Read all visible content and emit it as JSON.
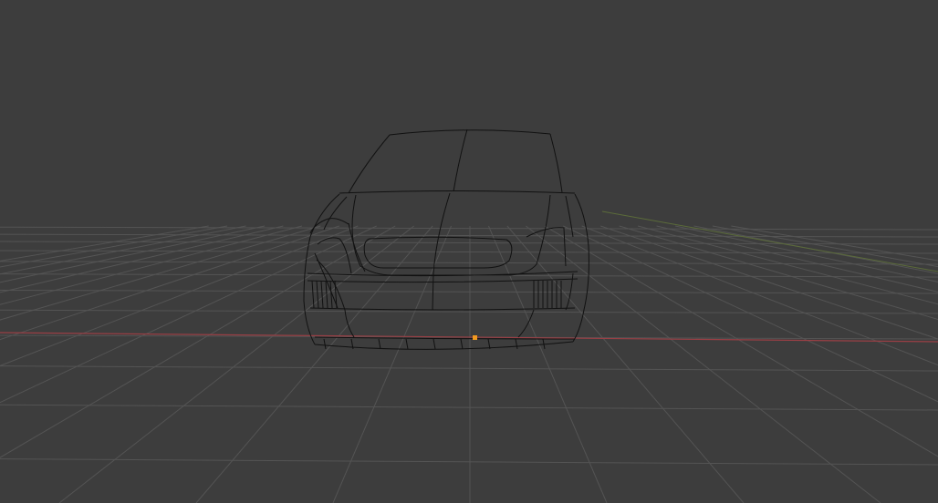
{
  "viewport": {
    "background": "#3d3d3d",
    "grid_color": "#545454",
    "x_axis_color": "#9a3f45",
    "y_axis_color": "#5b6b3a",
    "wire_color": "#111111",
    "origin_color": "#f29a1f"
  }
}
